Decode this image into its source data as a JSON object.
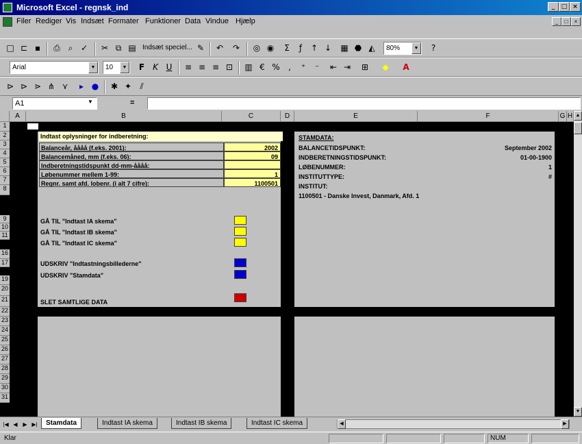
{
  "window": {
    "title": "Microsoft Excel - regnsk_ind"
  },
  "menu": [
    "Filer",
    "Rediger",
    "Vis",
    "Indsæt",
    "Formater",
    "Funktioner",
    "Data",
    "Vindue",
    "Hjælp"
  ],
  "toolbar": {
    "paste_special_label": "Indsæt speciel...",
    "zoom": "80%",
    "font_name": "Arial",
    "font_size": "10"
  },
  "formula_bar": {
    "cell_ref": "A1",
    "content": ""
  },
  "columns": [
    "A",
    "B",
    "C",
    "D",
    "E",
    "F",
    "G",
    "H"
  ],
  "rows": [
    "1",
    "2",
    "3",
    "4",
    "5",
    "6",
    "7",
    "8",
    "9",
    "10",
    "11",
    "16",
    "17",
    "19",
    "20",
    "21",
    "22",
    "23",
    "24",
    "25",
    "26",
    "27",
    "28",
    "29",
    "30",
    "31"
  ],
  "left_panel": {
    "header": "Indtast oplysninger for indberetning:",
    "fields": [
      {
        "label": "Balanceår, åååå (f.eks. 2001):",
        "value": "2002"
      },
      {
        "label": "Balancemåned, mm (f.eks. 06):",
        "value": "09"
      },
      {
        "label": "Indberetningstidspunkt dd-mm-åååå:",
        "value": ""
      },
      {
        "label": "Løbenummer mellem 1-99:",
        "value": "1"
      },
      {
        "label": "Regnr. samt afd. lobenr. (i alt 7 cifre):",
        "value": "1100501"
      }
    ],
    "macros": [
      {
        "label": "GÅ TIL \"Indtast IA skema\"",
        "color": "#ffff00"
      },
      {
        "label": "GÅ TIL \"Indtast IB skema\"",
        "color": "#ffff00"
      },
      {
        "label": "GÅ TIL \"Indtast IC skema\"",
        "color": "#ffff00"
      },
      {
        "label": "UDSKRIV \"Indtastningsbillederne\"",
        "color": "#0000cc"
      },
      {
        "label": "UDSKRIV \"Stamdata\"",
        "color": "#0000cc"
      },
      {
        "label": "SLET SAMTLIGE DATA",
        "color": "#cc0000"
      }
    ]
  },
  "right_panel": {
    "header": "STAMDATA:",
    "rows": [
      {
        "label": "BALANCETIDSPUNKT:",
        "value": "September 2002"
      },
      {
        "label": "INDBERETNINGSTIDSPUNKT:",
        "value": "01-00-1900"
      },
      {
        "label": "LØBENUMMER:",
        "value": "1"
      },
      {
        "label": "INSTITUTTYPE:",
        "value": "#"
      },
      {
        "label": "INSTITUT:",
        "value": ""
      }
    ],
    "institute_line": "1100501 - Danske Invest, Danmark, Afd. 1"
  },
  "sheet_tabs": [
    "Stamdata",
    "Indtast IA skema",
    "Indtast IB skema",
    "Indtast IC skema"
  ],
  "active_tab": 0,
  "status": {
    "left": "Klar",
    "right": "NUM"
  },
  "colors": {
    "title_bar": "#000080",
    "input_cell": "#ffff99",
    "sheet_bg": "#000000",
    "panel_bg": "#c0c0c0"
  }
}
